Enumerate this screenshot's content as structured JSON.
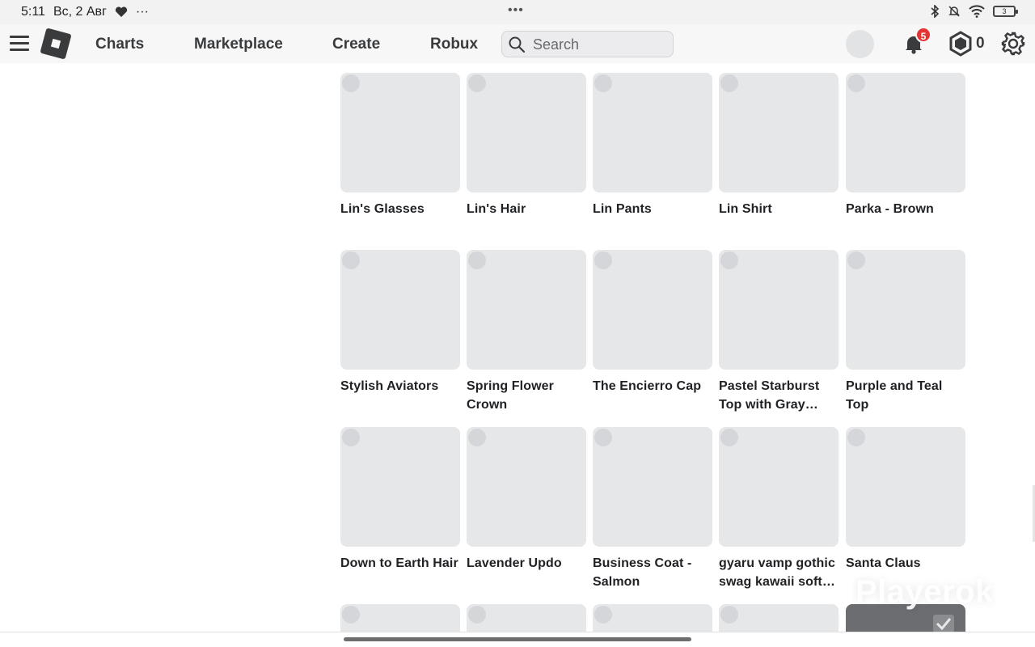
{
  "status_bar": {
    "time": "5:11",
    "date": "Вс, 2 Авг",
    "more": "···",
    "center_dots": "•••",
    "battery": "3"
  },
  "header": {
    "nav": [
      "Charts",
      "Marketplace",
      "Create",
      "Robux"
    ],
    "search_placeholder": "Search",
    "notification_count": "5",
    "robux_balance": "0"
  },
  "items": [
    "Lin's Glasses",
    "Lin's Hair",
    "Lin Pants",
    "Lin Shirt",
    "Parka - Brown",
    "Stylish Aviators",
    "Spring Flower Crown",
    "The Encierro Cap",
    "Pastel Starburst Top with Gray Jeans",
    "Purple and Teal Top",
    "Down to Earth Hair",
    "Lavender Updo",
    "Business Coat - Salmon",
    "gyaru vamp gothic swag kawaii soft girl",
    "Santa Claus"
  ],
  "watermark": "Playerok"
}
